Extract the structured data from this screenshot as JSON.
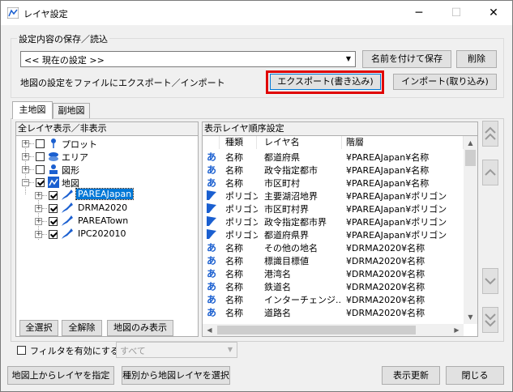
{
  "window": {
    "title": "レイヤ設定",
    "controls": {
      "minimize": "─",
      "maximize": "☐",
      "close": "✕"
    }
  },
  "save_group": {
    "label": "設定内容の保存／読込",
    "preset_select_value": "<< 現在の設定 >>",
    "save_as_label": "名前を付けて保存",
    "delete_label": "削除",
    "export_desc": "地図の設定をファイルにエクスポート／インポート",
    "export_label": "エクスポート(書き込み)",
    "import_label": "インポート(取り込み)"
  },
  "tabs": [
    {
      "label": "主地図",
      "active": true
    },
    {
      "label": "副地図",
      "active": false
    }
  ],
  "left_panel": {
    "header": "全レイヤ表示／非表示",
    "tree": [
      {
        "label": "プロット",
        "checked": false,
        "level": 0,
        "expanded": false,
        "icon": "pin-icon"
      },
      {
        "label": "エリア",
        "checked": false,
        "level": 0,
        "expanded": false,
        "icon": "area-icon"
      },
      {
        "label": "図形",
        "checked": false,
        "level": 0,
        "expanded": false,
        "icon": "shape-icon"
      },
      {
        "label": "地図",
        "checked": true,
        "level": 0,
        "expanded": true,
        "icon": "map-icon"
      },
      {
        "label": "PAREAJapan",
        "checked": true,
        "level": 1,
        "expanded": false,
        "icon": "japan-map-icon",
        "selected": true
      },
      {
        "label": "DRMA2020",
        "checked": true,
        "level": 1,
        "expanded": false,
        "icon": "japan-map-icon"
      },
      {
        "label": "PAREATown",
        "checked": true,
        "level": 1,
        "expanded": false,
        "icon": "japan-map-icon"
      },
      {
        "label": "IPC202010",
        "checked": true,
        "level": 1,
        "expanded": false,
        "icon": "japan-map-icon"
      }
    ],
    "buttons": {
      "select_all": "全選択",
      "deselect_all": "全解除",
      "map_only": "地図のみ表示"
    }
  },
  "right_panel": {
    "header": "表示レイヤ順序設定",
    "columns": [
      "種類",
      "レイヤ名",
      "階層"
    ],
    "rows": [
      {
        "icon": "text-icon",
        "type": "名称",
        "name": "都道府県",
        "path": "¥PAREAJapan¥名称"
      },
      {
        "icon": "text-icon",
        "type": "名称",
        "name": "政令指定都市",
        "path": "¥PAREAJapan¥名称"
      },
      {
        "icon": "text-icon",
        "type": "名称",
        "name": "市区町村",
        "path": "¥PAREAJapan¥名称"
      },
      {
        "icon": "polygon-icon",
        "type": "ポリゴン",
        "name": "主要湖沼地界",
        "path": "¥PAREAJapan¥ポリゴン"
      },
      {
        "icon": "polygon-icon",
        "type": "ポリゴン",
        "name": "市区町村界",
        "path": "¥PAREAJapan¥ポリゴン"
      },
      {
        "icon": "polygon-icon",
        "type": "ポリゴン",
        "name": "政令指定都市界",
        "path": "¥PAREAJapan¥ポリゴン"
      },
      {
        "icon": "polygon-icon",
        "type": "ポリゴン",
        "name": "都道府県界",
        "path": "¥PAREAJapan¥ポリゴン"
      },
      {
        "icon": "text-icon",
        "type": "名称",
        "name": "その他の地名",
        "path": "¥DRMA2020¥名称"
      },
      {
        "icon": "text-icon",
        "type": "名称",
        "name": "標識目標値",
        "path": "¥DRMA2020¥名称"
      },
      {
        "icon": "text-icon",
        "type": "名称",
        "name": "港湾名",
        "path": "¥DRMA2020¥名称"
      },
      {
        "icon": "text-icon",
        "type": "名称",
        "name": "鉄道名",
        "path": "¥DRMA2020¥名称"
      },
      {
        "icon": "text-icon",
        "type": "名称",
        "name": "インターチェンジ...",
        "path": "¥DRMA2020¥名称"
      },
      {
        "icon": "text-icon",
        "type": "名称",
        "name": "道路名",
        "path": "¥DRMA2020¥名称"
      }
    ]
  },
  "filter": {
    "checkbox_label": "フィルタを有効にする",
    "select_value": "すべて"
  },
  "bottom_buttons": {
    "pick_from_map": "地図上からレイヤを指定",
    "select_by_type": "種別から地図レイヤを選択",
    "refresh": "表示更新",
    "close": "閉じる"
  },
  "colors": {
    "highlight_border": "#e00000",
    "selection_bg": "#0078d7",
    "icon_blue": "#1a5fd0"
  }
}
